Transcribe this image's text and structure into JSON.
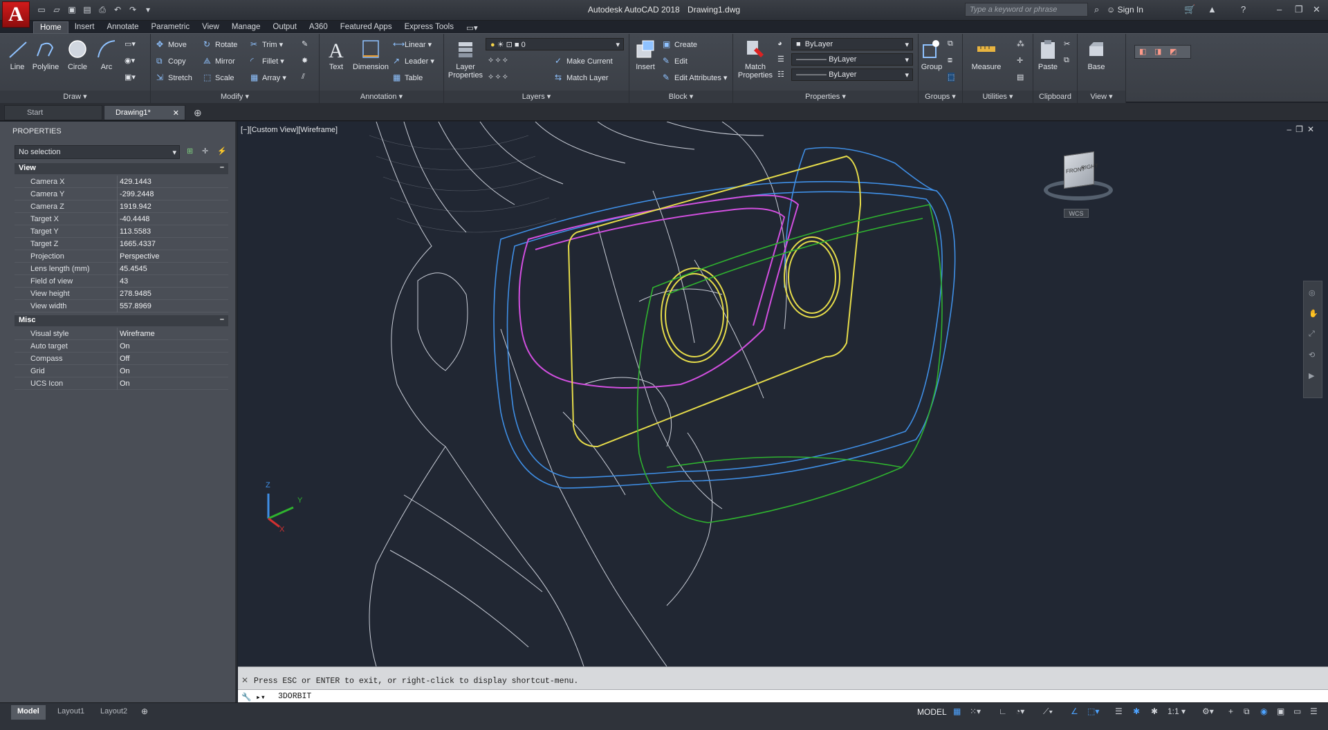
{
  "app": {
    "title": "Autodesk AutoCAD 2018",
    "filename": "Drawing1.dwg",
    "logo_letter": "A",
    "search_placeholder": "Type a keyword or phrase",
    "sign_in": "Sign In"
  },
  "ribbon_tabs": [
    "Home",
    "Insert",
    "Annotate",
    "Parametric",
    "View",
    "Manage",
    "Output",
    "A360",
    "Featured Apps",
    "Express Tools"
  ],
  "ribbon": {
    "draw": {
      "label": "Draw",
      "tools": [
        "Line",
        "Polyline",
        "Circle",
        "Arc"
      ]
    },
    "modify": {
      "label": "Modify",
      "tools": [
        "Move",
        "Rotate",
        "Trim",
        "Copy",
        "Mirror",
        "Fillet",
        "Stretch",
        "Scale",
        "Array"
      ]
    },
    "annotation": {
      "label": "Annotation",
      "tools": [
        "Text",
        "Dimension",
        "Linear",
        "Leader",
        "Table"
      ]
    },
    "layers": {
      "label": "Layers",
      "tools": [
        "Layer Properties",
        "Make Current",
        "Match Layer"
      ],
      "layer_value": "0"
    },
    "block": {
      "label": "Block",
      "tools": [
        "Insert",
        "Create",
        "Edit",
        "Edit Attributes"
      ]
    },
    "properties": {
      "label": "Properties",
      "tools": [
        "Match Properties"
      ],
      "color": "ByLayer",
      "linetype": "ByLayer",
      "lineweight": "ByLayer"
    },
    "groups": {
      "label": "Groups",
      "tools": [
        "Group"
      ]
    },
    "utilities": {
      "label": "Utilities",
      "tools": [
        "Measure"
      ]
    },
    "clipboard": {
      "label": "Clipboard",
      "tools": [
        "Paste"
      ]
    },
    "view": {
      "label": "View",
      "tools": [
        "Base"
      ]
    }
  },
  "file_tabs": [
    "Start",
    "Drawing1*"
  ],
  "properties_panel": {
    "title": "PROPERTIES",
    "selection": "No selection",
    "sections": [
      {
        "name": "View",
        "rows": [
          {
            "key": "Camera X",
            "value": "429.1443"
          },
          {
            "key": "Camera Y",
            "value": "-299.2448"
          },
          {
            "key": "Camera Z",
            "value": "1919.942"
          },
          {
            "key": "Target X",
            "value": "-40.4448"
          },
          {
            "key": "Target Y",
            "value": "113.5583"
          },
          {
            "key": "Target Z",
            "value": "1665.4337"
          },
          {
            "key": "Projection",
            "value": "Perspective"
          },
          {
            "key": "Lens length (mm)",
            "value": "45.4545"
          },
          {
            "key": "Field of view",
            "value": "43"
          },
          {
            "key": "View height",
            "value": "278.9485"
          },
          {
            "key": "View width",
            "value": "557.8969"
          }
        ]
      },
      {
        "name": "Misc",
        "rows": [
          {
            "key": "Visual style",
            "value": "Wireframe"
          },
          {
            "key": "Auto target",
            "value": "On"
          },
          {
            "key": "Compass",
            "value": "Off"
          },
          {
            "key": "Grid",
            "value": "On"
          },
          {
            "key": "UCS Icon",
            "value": "On"
          }
        ]
      }
    ]
  },
  "viewport": {
    "label": "[−][Custom View][Wireframe]",
    "viewcube_front": "FRONT",
    "viewcube_right": "RIGHT",
    "wcs": "WCS",
    "axis_x": "X",
    "axis_y": "Y",
    "axis_z": "Z"
  },
  "command_line": {
    "message": "Press ESC or ENTER to exit, or right-click to display shortcut-menu.",
    "input": "3DORBIT"
  },
  "layout_tabs": [
    "Model",
    "Layout1",
    "Layout2"
  ],
  "status_bar": {
    "model_label": "MODEL",
    "scale": "1:1"
  },
  "colors": {
    "accent": "#c8161b",
    "wire_white": "#e8ecf5",
    "wire_blue": "#3f8fe6",
    "wire_green": "#2fb32f",
    "wire_yellow": "#e6dc4a",
    "wire_magenta": "#d24fe0"
  }
}
